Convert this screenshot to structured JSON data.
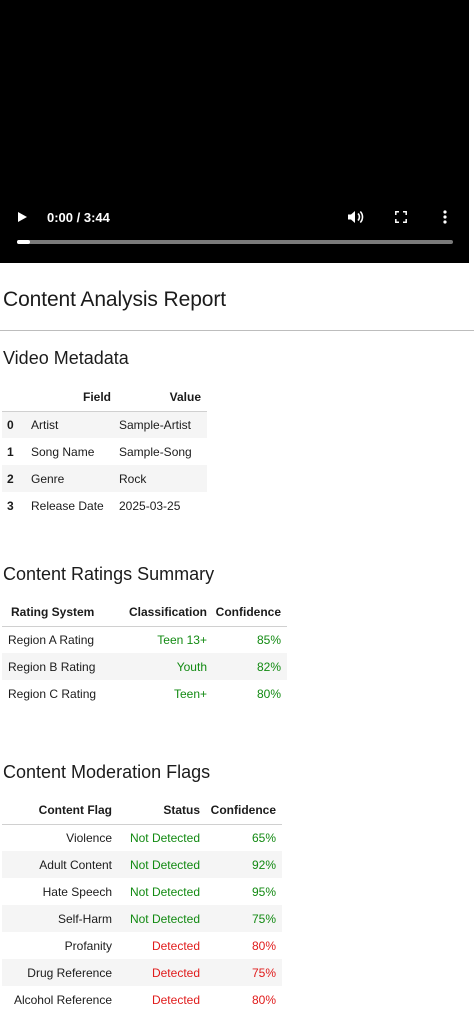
{
  "colors": {
    "ok": "#128a12",
    "flagged": "#e01b1b",
    "video_bg": "#000000"
  },
  "video": {
    "time": "0:00 / 3:44",
    "progress": 0.03,
    "icons": [
      "play-icon",
      "volume-icon",
      "fullscreen-icon",
      "more-options-icon"
    ]
  },
  "report": {
    "title": "Content Analysis Report"
  },
  "metadata": {
    "heading": "Video Metadata",
    "columns": [
      "",
      "Field",
      "Value"
    ],
    "rows": [
      [
        "0",
        "Artist",
        "Sample-Artist"
      ],
      [
        "1",
        "Song Name",
        "Sample-Song"
      ],
      [
        "2",
        "Genre",
        "Rock"
      ],
      [
        "3",
        "Release Date",
        "2025-03-25"
      ]
    ]
  },
  "ratings": {
    "heading": "Content Ratings Summary",
    "columns": [
      "Rating System",
      "Classification",
      "Confidence"
    ],
    "rows": [
      [
        "Region A Rating",
        "Teen 13+",
        "85%"
      ],
      [
        "Region B Rating",
        "Youth",
        "82%"
      ],
      [
        "Region C Rating",
        "Teen+",
        "80%"
      ]
    ]
  },
  "flags": {
    "heading": "Content Moderation Flags",
    "columns": [
      "Content Flag",
      "Status",
      "Confidence"
    ],
    "rows": [
      [
        "Violence",
        "Not Detected",
        "65%"
      ],
      [
        "Adult Content",
        "Not Detected",
        "92%"
      ],
      [
        "Hate Speech",
        "Not Detected",
        "95%"
      ],
      [
        "Self-Harm",
        "Not Detected",
        "75%"
      ],
      [
        "Profanity",
        "Detected",
        "80%"
      ],
      [
        "Drug Reference",
        "Detected",
        "75%"
      ],
      [
        "Alcohol Reference",
        "Detected",
        "80%"
      ]
    ]
  }
}
